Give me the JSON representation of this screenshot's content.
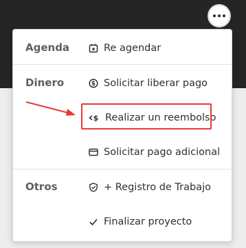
{
  "header": {
    "more_button_icon": "more-horizontal-icon"
  },
  "menu": {
    "sections": [
      {
        "label": "Agenda"
      },
      {
        "label": "Dinero"
      },
      {
        "label": "Otros"
      }
    ],
    "items": [
      {
        "label": "Re agendar",
        "icon": "calendar-icon"
      },
      {
        "label": "Solicitar liberar pago",
        "icon": "dollar-circle-icon"
      },
      {
        "label": "Realizar un reembolso",
        "icon": "refund-icon",
        "highlighted": true
      },
      {
        "label": "Solicitar pago adicional",
        "icon": "card-icon"
      },
      {
        "label": "+ Registro de Trabajo",
        "icon": "shield-check-icon"
      },
      {
        "label": "Finalizar proyecto",
        "icon": "checkmark-icon"
      }
    ]
  },
  "colors": {
    "highlight": "#e53935",
    "topbar": "#252525"
  }
}
